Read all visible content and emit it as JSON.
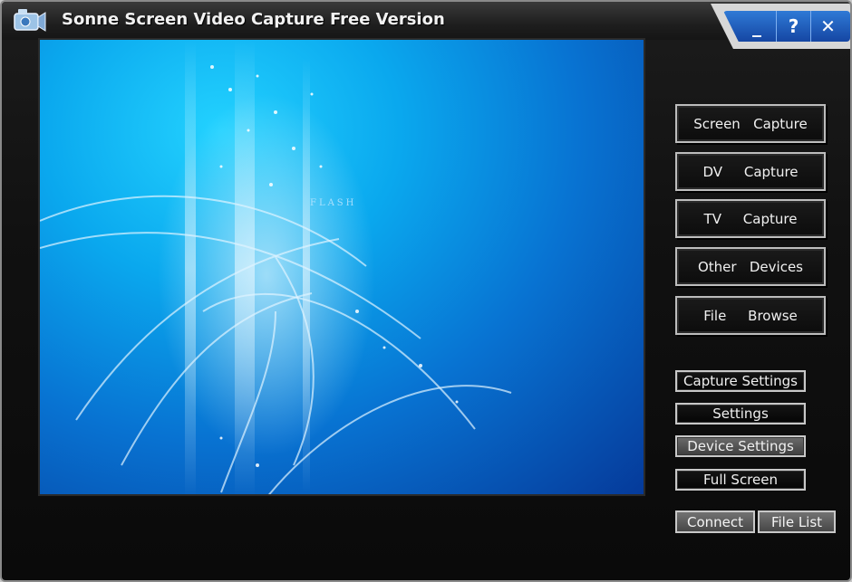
{
  "window": {
    "title": "Sonne Screen Video Capture Free Version",
    "controls": {
      "minimize": "_",
      "help": "?",
      "close": "✕"
    }
  },
  "preview": {
    "overlay_text": "FLASH"
  },
  "capture_buttons": [
    {
      "label": "Screen   Capture"
    },
    {
      "label": "DV     Capture"
    },
    {
      "label": "TV     Capture"
    },
    {
      "label": "Other   Devices"
    },
    {
      "label": "File     Browse"
    }
  ],
  "settings_buttons": [
    {
      "label": "Capture Settings"
    },
    {
      "label": "Settings"
    },
    {
      "label": "Device Settings"
    },
    {
      "label": "Full Screen"
    }
  ],
  "bottom_buttons": {
    "connect": "Connect",
    "file_list": "File List"
  },
  "colors": {
    "accent_blue": "#1e5fc4",
    "preview_cyan": "#0aa8ee",
    "window_dark": "#111111"
  }
}
